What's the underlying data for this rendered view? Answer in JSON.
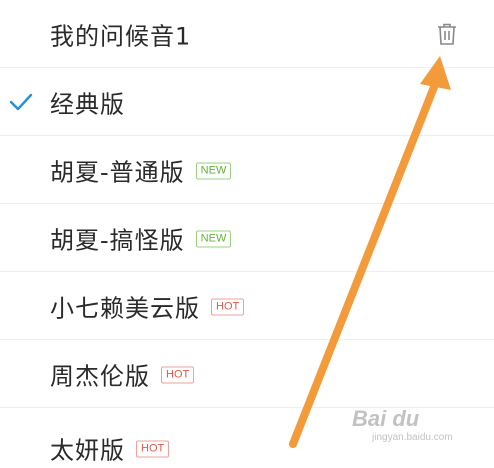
{
  "ringtone_list": {
    "items": [
      {
        "label": "我的问候音1",
        "selected": false,
        "badge": null,
        "deletable": true,
        "icon": "trash-icon"
      },
      {
        "label": "经典版",
        "selected": true,
        "badge": null,
        "deletable": false,
        "icon": "checkmark-icon"
      },
      {
        "label": "胡夏-普通版",
        "selected": false,
        "badge": "NEW",
        "deletable": false
      },
      {
        "label": "胡夏-搞怪版",
        "selected": false,
        "badge": "NEW",
        "deletable": false
      },
      {
        "label": "小七赖美云版",
        "selected": false,
        "badge": "HOT",
        "deletable": false
      },
      {
        "label": "周杰伦版",
        "selected": false,
        "badge": "HOT",
        "deletable": false
      },
      {
        "label": "太妍版",
        "selected": false,
        "badge": "HOT",
        "deletable": false
      }
    ]
  },
  "colors": {
    "check": "#2b8fd6",
    "new_badge": "#5fb336",
    "hot_badge": "#e05a4b",
    "annotation_arrow": "#f39a3b"
  },
  "watermark": {
    "main": "Bai du",
    "sub": "jingyan.baidu.com"
  }
}
